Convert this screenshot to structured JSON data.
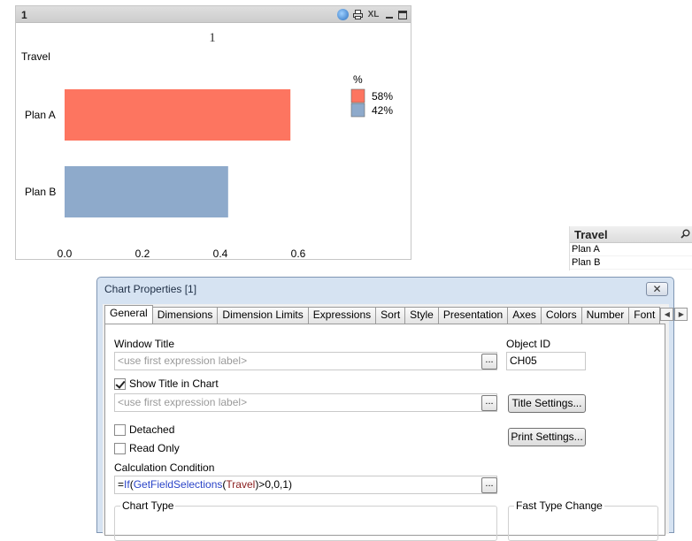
{
  "chart_window": {
    "caption": "1",
    "icons": [
      "globe-icon",
      "print-icon",
      "xl-icon",
      "minimize-icon",
      "maximize-icon"
    ],
    "xl_label": "XL"
  },
  "chart_data": {
    "type": "bar",
    "orientation": "horizontal",
    "title": "1",
    "dimension_label": "Travel",
    "categories": [
      "Plan A",
      "Plan B"
    ],
    "values": [
      0.58,
      0.42
    ],
    "colors": [
      "#fd7560",
      "#8eaacb"
    ],
    "xlim": [
      0,
      0.8
    ],
    "x_ticks": [
      0.0,
      0.2,
      0.4,
      0.6
    ],
    "x_tick_labels": [
      "0.0",
      "0.2",
      "0.4",
      "0.6"
    ],
    "grid": false,
    "legend": {
      "title": "%",
      "placement": "top-right",
      "entries": [
        {
          "label": "58%",
          "color": "#fd7560"
        },
        {
          "label": "42%",
          "color": "#8eaacb"
        }
      ]
    }
  },
  "listbox": {
    "title": "Travel",
    "items": [
      "Plan A",
      "Plan B"
    ]
  },
  "dialog": {
    "title": "Chart Properties [1]",
    "close_label": "✕",
    "tabs": [
      "General",
      "Dimensions",
      "Dimension Limits",
      "Expressions",
      "Sort",
      "Style",
      "Presentation",
      "Axes",
      "Colors",
      "Number",
      "Font"
    ],
    "active_tab": "General",
    "window_title_label": "Window Title",
    "window_title_placeholder": "<use first expression label>",
    "object_id_label": "Object ID",
    "object_id_value": "CH05",
    "show_title_label": "Show Title in Chart",
    "show_title_checked": true,
    "show_title_placeholder": "<use first expression label>",
    "title_settings_label": "Title Settings...",
    "detached_label": "Detached",
    "detached_checked": false,
    "read_only_label": "Read Only",
    "read_only_checked": false,
    "print_settings_label": "Print Settings...",
    "calc_condition_label": "Calculation Condition",
    "calc_condition": {
      "prefix": "=",
      "fn1": "If",
      "p1": "(",
      "fn2": "GetFieldSelections",
      "p2": "(",
      "field": "Travel",
      "suffix": ")>0,0,1)"
    },
    "ellipsis_label": "...",
    "chart_type_label": "Chart Type",
    "fast_type_change_label": "Fast Type Change"
  }
}
